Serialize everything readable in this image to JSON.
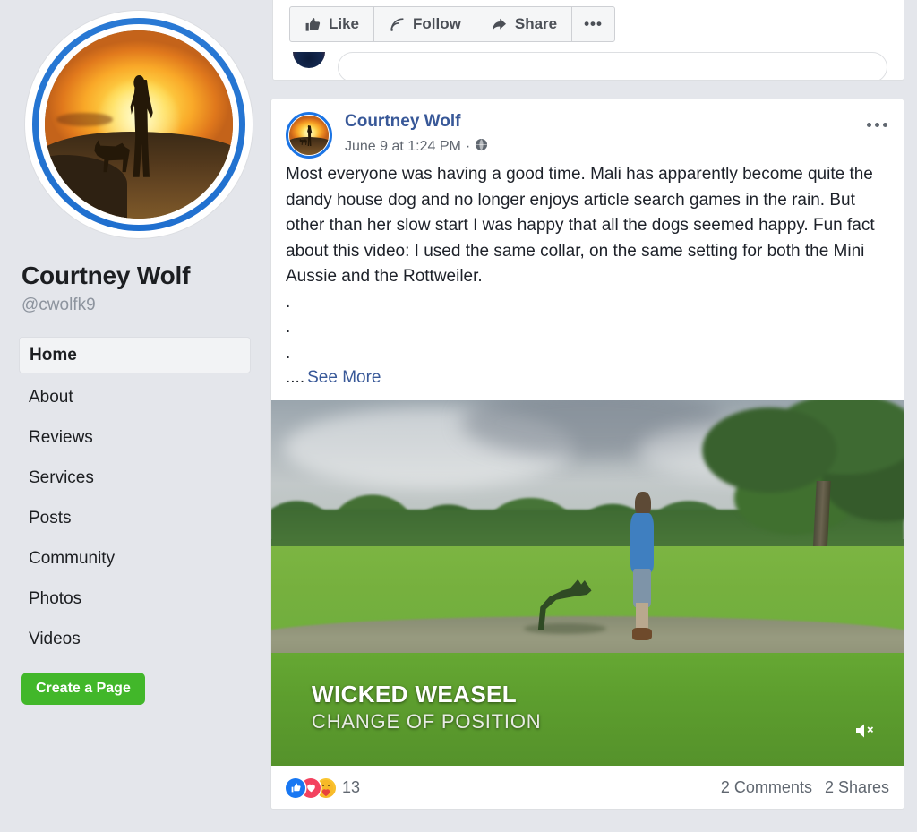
{
  "sidebar": {
    "avatar_alt": "profile-photo-sunset-person-with-dog",
    "page_name": "Courtney Wolf",
    "handle": "@cwolfk9",
    "nav_items": [
      {
        "label": "Home",
        "active": true
      },
      {
        "label": "About",
        "active": false
      },
      {
        "label": "Reviews",
        "active": false
      },
      {
        "label": "Services",
        "active": false
      },
      {
        "label": "Posts",
        "active": false
      },
      {
        "label": "Community",
        "active": false
      },
      {
        "label": "Photos",
        "active": false
      },
      {
        "label": "Videos",
        "active": false
      }
    ],
    "create_page_label": "Create a Page",
    "create_page_color": "#42b72a"
  },
  "action_bar": {
    "like_label": "Like",
    "follow_label": "Follow",
    "share_label": "Share",
    "more_label": "•••"
  },
  "post": {
    "author": "Courtney Wolf",
    "author_color": "#385898",
    "timestamp": "June 9 at 1:24 PM",
    "meta_separator": "·",
    "privacy_icon": "globe-icon",
    "menu_icon": "ellipsis-icon",
    "body": "Most everyone was having a good time. Mali has apparently become quite the dandy house dog and no longer enjoys article search games in the rain. But other than her slow start I was happy that all the dogs seemed happy. Fun fact about this video: I used the same collar, on the same setting for both the Mini Aussie and the Rottweiler.",
    "dot_lines": [
      ".",
      ".",
      "."
    ],
    "truncation_dots": "....",
    "see_more_label": "See More",
    "video": {
      "caption_title": "WICKED WEASEL",
      "caption_subtitle": "CHANGE OF POSITION",
      "mute_icon": "speaker-muted-icon"
    },
    "reactions": {
      "icons": [
        "like-icon",
        "love-icon",
        "care-icon"
      ],
      "count": "13"
    },
    "comments_label": "2 Comments",
    "shares_label": "2 Shares"
  }
}
